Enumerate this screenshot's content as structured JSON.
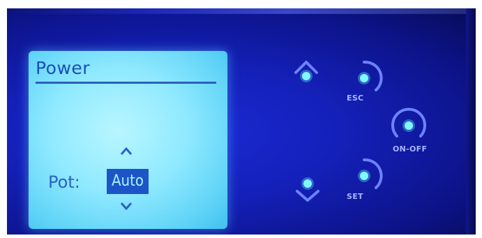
{
  "lcd": {
    "title": "Power",
    "field_label": "Pot:",
    "field_value": "Auto"
  },
  "buttons": {
    "esc_label": "ESC",
    "onoff_label": "ON-OFF",
    "set_label": "SET"
  },
  "icons": {
    "lcd_up": "chevron-up-icon",
    "lcd_down": "chevron-down-icon",
    "up_button": "up-arrow-led-icon",
    "down_button": "down-arrow-led-icon"
  },
  "colors": {
    "panel_blue": "#1420b8",
    "lcd_cyan": "#8fe9ff",
    "lcd_text": "#1a4fb8",
    "led": "#5ff0ff"
  }
}
